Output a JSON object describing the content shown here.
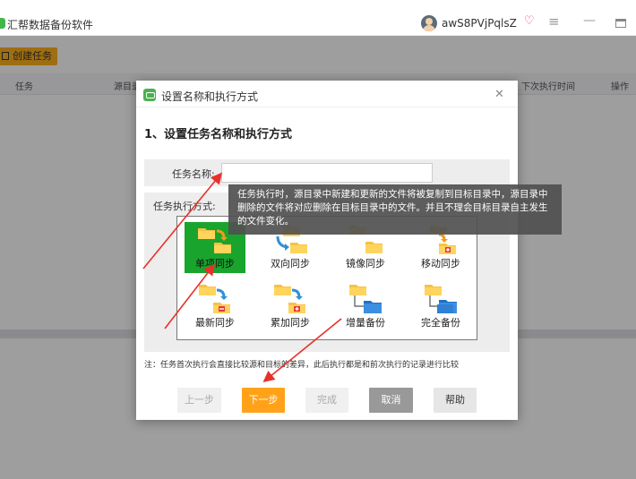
{
  "app": {
    "title": "汇帮数据备份软件",
    "user_name": "awS8PVjPqlsZ",
    "create_task_label": "创建任务"
  },
  "table": {
    "headers": [
      "任务",
      "源目录",
      "下次执行时间",
      "操作"
    ]
  },
  "dialog": {
    "title": "设置名称和执行方式",
    "heading": "1、设置任务名称和执行方式",
    "name_label": "任务名称:",
    "name_value": "",
    "mode_label": "任务执行方式:",
    "modes": [
      {
        "label": "单项同步",
        "selected": true
      },
      {
        "label": "双向同步",
        "selected": false
      },
      {
        "label": "镜像同步",
        "selected": false
      },
      {
        "label": "移动同步",
        "selected": false
      },
      {
        "label": "最新同步",
        "selected": false
      },
      {
        "label": "累加同步",
        "selected": false
      },
      {
        "label": "增量备份",
        "selected": false
      },
      {
        "label": "完全备份",
        "selected": false
      }
    ],
    "tooltip": "任务执行时，源目录中新建和更新的文件将被复制到目标目录中，源目录中删除的文件将对应删除在目标目录中的文件。并且不理会目标目录自主发生的文件变化。",
    "note": "注：任务首次执行会直接比较源和目标的差异，此后执行都是和前次执行的记录进行比较",
    "buttons": {
      "prev": "上一步",
      "next": "下一步",
      "finish": "完成",
      "cancel": "取消",
      "help": "帮助"
    }
  },
  "colors": {
    "accent": "#ffa21a",
    "selected_mode": "#19a42e",
    "annotation": "#e8312a"
  }
}
